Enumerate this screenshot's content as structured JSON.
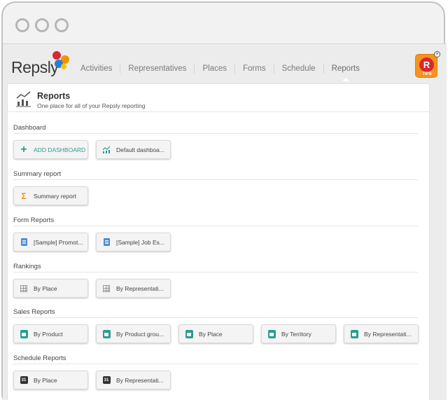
{
  "brand": {
    "name": "Repsly"
  },
  "nav": {
    "items": [
      {
        "label": "Activities"
      },
      {
        "label": "Representatives"
      },
      {
        "label": "Places"
      },
      {
        "label": "Forms"
      },
      {
        "label": "Schedule"
      },
      {
        "label": "Reports"
      }
    ],
    "active": "Reports"
  },
  "tips": {
    "label": "TIPS",
    "letter": "R"
  },
  "page": {
    "title": "Reports",
    "subtitle": "One place for all of your Repsly reporting"
  },
  "sections": {
    "dashboard": {
      "title": "Dashboard",
      "add_label": "ADD DASHBOARD",
      "items": [
        "Default dashboa..."
      ]
    },
    "summary": {
      "title": "Summary report",
      "items": [
        "Summary report"
      ]
    },
    "forms": {
      "title": "Form Reports",
      "items": [
        "[Sample] Promot...",
        "[Sample] Job Es..."
      ]
    },
    "rankings": {
      "title": "Rankings",
      "items": [
        "By Place",
        "By Representati..."
      ]
    },
    "sales": {
      "title": "Sales Reports",
      "items": [
        "By Product",
        "By Product grou...",
        "By Place",
        "By Territory",
        "By Representati..."
      ]
    },
    "schedule": {
      "title": "Schedule Reports",
      "items": [
        "By Place",
        "By Representati..."
      ],
      "calendar_day": "31"
    }
  },
  "colors": {
    "accent": "#2a9d8f",
    "orange": "#f39200",
    "tips_red": "#d7282f"
  }
}
